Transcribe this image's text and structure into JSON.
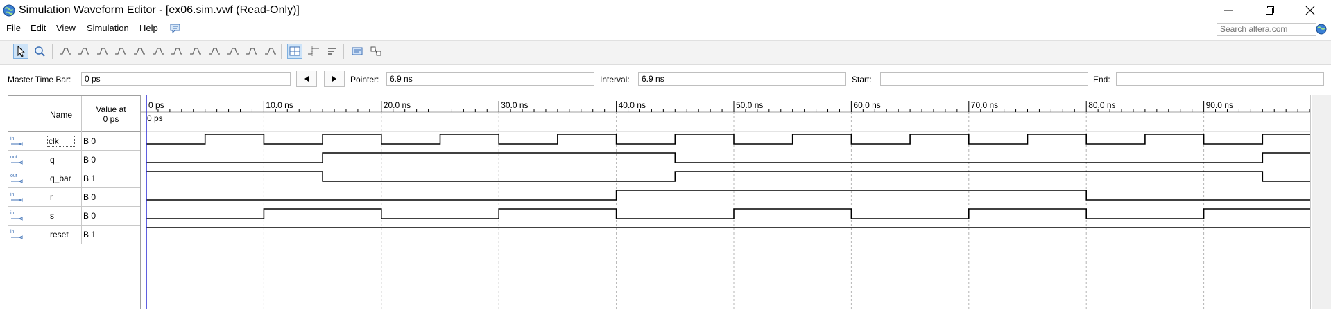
{
  "window": {
    "title": "Simulation Waveform Editor - [ex06.sim.vwf (Read-Only)]"
  },
  "menu": {
    "items": [
      "File",
      "Edit",
      "View",
      "Simulation",
      "Help"
    ]
  },
  "search": {
    "placeholder": "Search altera.com"
  },
  "toolbar": {
    "icons": [
      "pointer-tool-icon",
      "zoom-tool-icon",
      "force-unknown-icon",
      "force-low-icon",
      "force-high-icon",
      "force-high-impedance-icon",
      "force-weak-low-icon",
      "force-weak-high-icon",
      "invert-icon",
      "count-value-icon",
      "force-dont-care-icon",
      "random-values-icon",
      "arbitrary-value-icon",
      "clock-value-icon",
      "snap-to-grid-icon",
      "snap-to-transition-icon",
      "sort-icon",
      "group-icon",
      "ungroup-icon"
    ]
  },
  "timebar": {
    "master_label": "Master Time Bar:",
    "master_value": "0 ps",
    "pointer_label": "Pointer:",
    "pointer_value": "6.9 ns",
    "interval_label": "Interval:",
    "interval_value": "6.9 ns",
    "start_label": "Start:",
    "start_value": "",
    "end_label": "End:",
    "end_value": ""
  },
  "signals_header": {
    "name": "Name",
    "value_line1": "Value at",
    "value_line2": "0 ps"
  },
  "signals": [
    {
      "dir": "in",
      "name": "clk",
      "value": "B 0"
    },
    {
      "dir": "out",
      "name": "q",
      "value": "B 0"
    },
    {
      "dir": "out",
      "name": "q_bar",
      "value": "B 1"
    },
    {
      "dir": "in",
      "name": "r",
      "value": "B 0"
    },
    {
      "dir": "in",
      "name": "s",
      "value": "B 0"
    },
    {
      "dir": "in",
      "name": "reset",
      "value": "B 1"
    }
  ],
  "timeline": {
    "ticks": [
      "0 ps",
      "10.0 ns",
      "20.0 ns",
      "30.0 ns",
      "40.0 ns",
      "50.0 ns",
      "60.0 ns",
      "70.0 ns",
      "80.0 ns",
      "90.0 ns",
      "100.0 ns"
    ],
    "tick_values_ns": [
      0,
      10,
      20,
      30,
      40,
      50,
      60,
      70,
      80,
      90,
      100
    ],
    "range_ns": [
      0,
      99.0
    ],
    "cursor_label": "0 ps",
    "cursor_ns": 0
  },
  "waveforms": {
    "clk": {
      "initial": 0,
      "transitions_ns": [
        5,
        10,
        15,
        20,
        25,
        30,
        35,
        40,
        45,
        50,
        55,
        60,
        65,
        70,
        75,
        80,
        85,
        90,
        95
      ]
    },
    "q": {
      "initial": 0,
      "transitions_ns": [
        15,
        45,
        95
      ]
    },
    "q_bar": {
      "initial": 1,
      "transitions_ns": [
        15,
        45,
        95
      ]
    },
    "r": {
      "initial": 0,
      "transitions_ns": [
        40,
        80
      ]
    },
    "s": {
      "initial": 0,
      "transitions_ns": [
        10,
        20,
        30,
        40,
        50,
        60,
        70,
        80,
        90
      ]
    },
    "reset": {
      "initial": 1,
      "transitions_ns": []
    }
  },
  "colors": {
    "wave": "#000000",
    "cursor": "#2b2bd6",
    "grid": "#b4b4b4",
    "pin_icon": "#3c6fb4"
  }
}
